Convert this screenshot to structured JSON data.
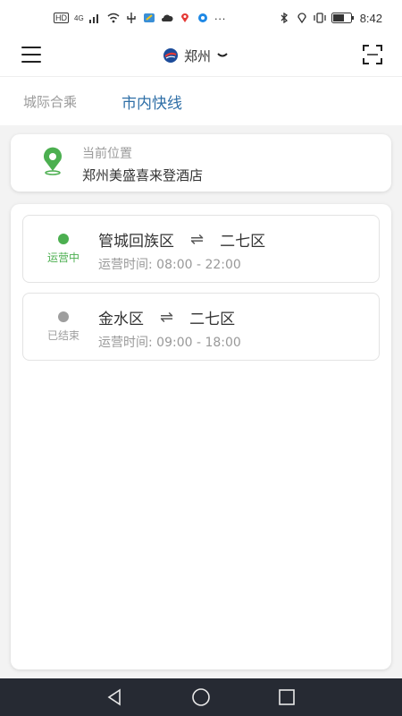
{
  "status_bar": {
    "time": "8:42",
    "network_label": "HD",
    "signal_label": "4G",
    "more": "···"
  },
  "header": {
    "city": "郑州",
    "icons": {
      "menu": "hamburger-menu-icon",
      "city_logo": "company-logo-icon",
      "dropdown": "chevron-down-icon",
      "scan": "scan-icon"
    }
  },
  "tabs": [
    {
      "label": "城际合乘",
      "active": false
    },
    {
      "label": "市内快线",
      "active": true
    }
  ],
  "location": {
    "label": "当前位置",
    "name": "郑州美盛喜来登酒店",
    "pin_color": "#4caf50"
  },
  "routes": [
    {
      "from": "管城回族区",
      "arrow": "⇌",
      "to": "二七区",
      "hours": "运营时间: 08:00 - 22:00",
      "status": "运营中",
      "status_color": "#4caf50"
    },
    {
      "from": "金水区",
      "arrow": "⇌",
      "to": "二七区",
      "hours": "运营时间: 09:00 - 18:00",
      "status": "已结束",
      "status_color": "#9e9e9e"
    }
  ],
  "navbar": {
    "back": "back-triangle-icon",
    "home": "home-circle-icon",
    "recents": "recents-square-icon"
  },
  "colors": {
    "accent": "#2f6fa7",
    "running": "#4caf50",
    "ended": "#9e9e9e"
  }
}
